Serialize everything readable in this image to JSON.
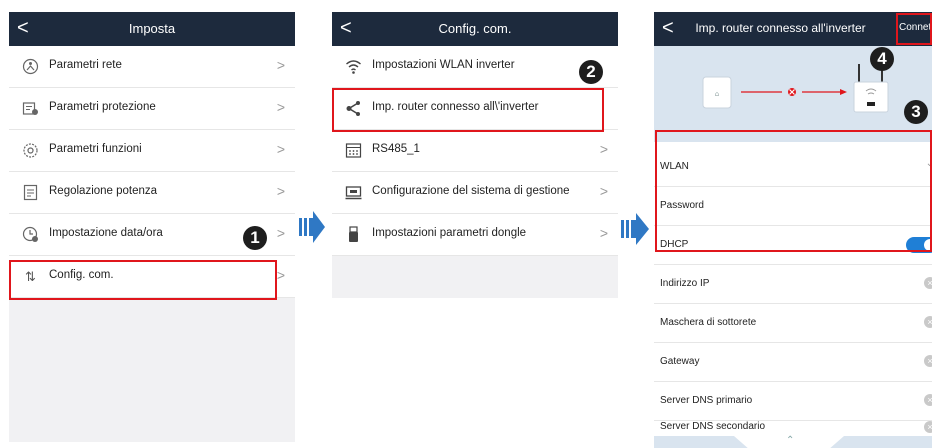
{
  "screen1": {
    "title": "Imposta",
    "back": "<",
    "items": [
      {
        "label": "Parametri rete",
        "chevron": ">"
      },
      {
        "label": "Parametri protezione",
        "chevron": ">"
      },
      {
        "label": "Parametri funzioni",
        "chevron": ">"
      },
      {
        "label": "Regolazione potenza",
        "chevron": ">"
      },
      {
        "label": "Impostazione data/ora",
        "chevron": ">"
      },
      {
        "label": "Config. com.",
        "chevron": ">"
      }
    ],
    "step": "1"
  },
  "screen2": {
    "title": "Config. com.",
    "back": "<",
    "items": [
      {
        "label": "Impostazioni WLAN inverter",
        "chevron": ""
      },
      {
        "label": "Imp. router connesso all\\'inverter",
        "chevron": ""
      },
      {
        "label": "RS485_1",
        "chevron": ">"
      },
      {
        "label": "Configurazione del sistema di gestione",
        "chevron": ">"
      },
      {
        "label": "Impostazioni parametri dongle",
        "chevron": ">"
      }
    ],
    "step": "2"
  },
  "screen3": {
    "title": "Imp. router connesso all'inverter",
    "back": "<",
    "connect_label": "Connett",
    "step_connect": "4",
    "step_fields": "3",
    "fields": [
      {
        "label": "WLAN"
      },
      {
        "label": "Password"
      },
      {
        "label": "DHCP",
        "toggle_on": true
      },
      {
        "label": "Indirizzo IP"
      },
      {
        "label": "Maschera di sottorete"
      },
      {
        "label": "Gateway"
      },
      {
        "label": "Server DNS primario"
      },
      {
        "label": "Server DNS secondario"
      }
    ]
  },
  "colors": {
    "header_bg": "#1d2a3d",
    "highlight": "#e0161c",
    "flow_arrow": "#2f78c4",
    "toggle": "#1f7fd6"
  }
}
